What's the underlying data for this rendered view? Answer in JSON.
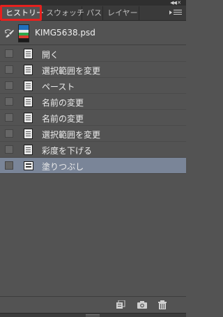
{
  "window": {
    "collapse_icon": "double-chevron-left-icon",
    "close_icon": "close-icon"
  },
  "tabs": [
    {
      "label": "ヒストリー",
      "active": true
    },
    {
      "label": "スウォッチ",
      "active": false
    },
    {
      "label": "パス",
      "active": false
    },
    {
      "label": "レイヤー",
      "active": false
    }
  ],
  "snapshot": {
    "name": "KIMG5638.psd",
    "brush_icon": "history-brush-icon"
  },
  "history": [
    {
      "label": "開く",
      "icon": "document-icon",
      "selected": false
    },
    {
      "label": "選択範囲を変更",
      "icon": "document-icon",
      "selected": false
    },
    {
      "label": "ペースト",
      "icon": "document-icon",
      "selected": false
    },
    {
      "label": "名前の変更",
      "icon": "document-icon",
      "selected": false
    },
    {
      "label": "名前の変更",
      "icon": "document-icon",
      "selected": false
    },
    {
      "label": "選択範囲を変更",
      "icon": "document-icon",
      "selected": false
    },
    {
      "label": "彩度を下げる",
      "icon": "document-icon",
      "selected": false
    },
    {
      "label": "塗りつぶし",
      "icon": "fill-icon",
      "selected": true
    }
  ],
  "footer": {
    "icons": [
      "new-document-from-state-icon",
      "camera-icon",
      "trash-icon"
    ]
  },
  "colors": {
    "panel": "#535353",
    "selected_row": "#7a8598",
    "active_tab_highlight": "#e6211e"
  }
}
